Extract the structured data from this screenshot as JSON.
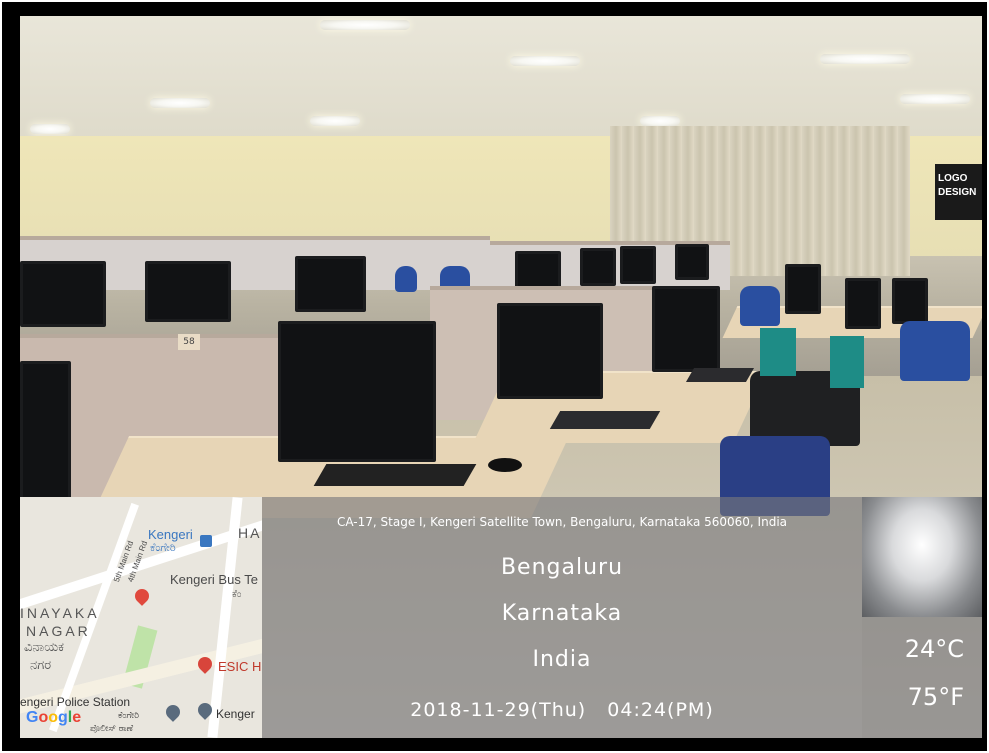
{
  "overlay": {
    "address": "CA-17, Stage I, Kengeri Satellite Town, Bengaluru, Karnataka 560060, India",
    "city": "Bengaluru",
    "state": "Karnataka",
    "country": "India",
    "datetime": "2018-11-29(Thu)   04:24(PM)"
  },
  "weather": {
    "temp_c": "24°C",
    "temp_f": "75°F"
  },
  "map": {
    "labels": {
      "kengeri": "Kengeri",
      "kengeri_kn": "ಕೆಂಗೇರಿ",
      "ha": "HA",
      "bus_terminal": "Kengeri Bus Te",
      "bus_terminal_kn": "ಕೆಂ",
      "road_5th": "5th Main Rd",
      "road_4th": "4th Main Rd",
      "vinayaka": "INAYAKA",
      "nagar": "NAGAR",
      "vinayaka_kn": "ವಿನಾಯಕ",
      "nagar_kn": "ನಗರ",
      "esic": "ESIC H",
      "police": "engeri Police Station",
      "police_kn": "ಕೆಂಗೇರಿ",
      "police_kn2": "ಪೊಲೀಸ್ ಠಾಣೆ",
      "kenger": "Kenger",
      "google": "Google"
    }
  },
  "scene": {
    "wall_sign": "LOGO DESIGN",
    "desk_number": "58"
  },
  "colors": {
    "frame": "#000000",
    "overlay_panel": "#78787d",
    "chair_blue": "#2a4fa0",
    "desk": "#e7d5b6",
    "pin_red": "#e0493d"
  }
}
